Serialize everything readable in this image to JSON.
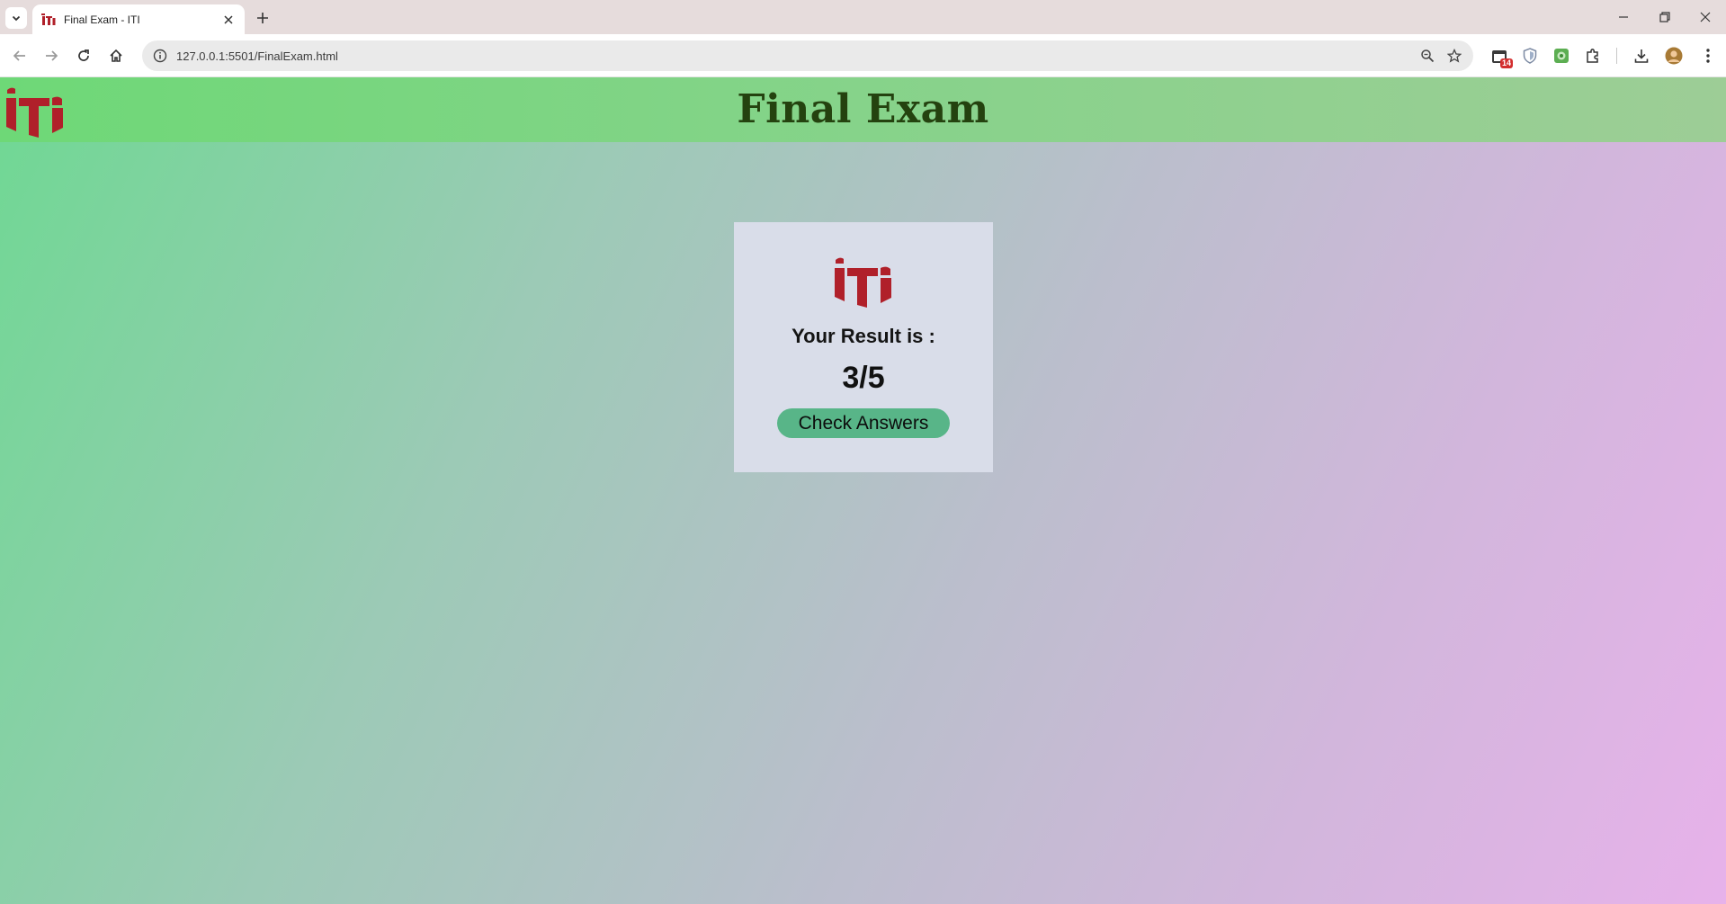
{
  "browser": {
    "tab": {
      "title": "Final Exam - ITI",
      "favicon": "iti-logo-icon"
    },
    "url": "127.0.0.1:5501/FinalExam.html",
    "extension_badge": "14",
    "colors": {
      "tabstrip": "#e6dcdc",
      "omnibox": "#eaeaea"
    }
  },
  "header": {
    "title": "Final Exam",
    "logo": "iti-logo",
    "colors": {
      "title": "#24420f",
      "background_start": "#6ed877"
    }
  },
  "result": {
    "label": "Your Result is :",
    "score": "3/5",
    "button_label": "Check Answers",
    "colors": {
      "card": "#d9dde9",
      "button": "#58b588"
    }
  }
}
